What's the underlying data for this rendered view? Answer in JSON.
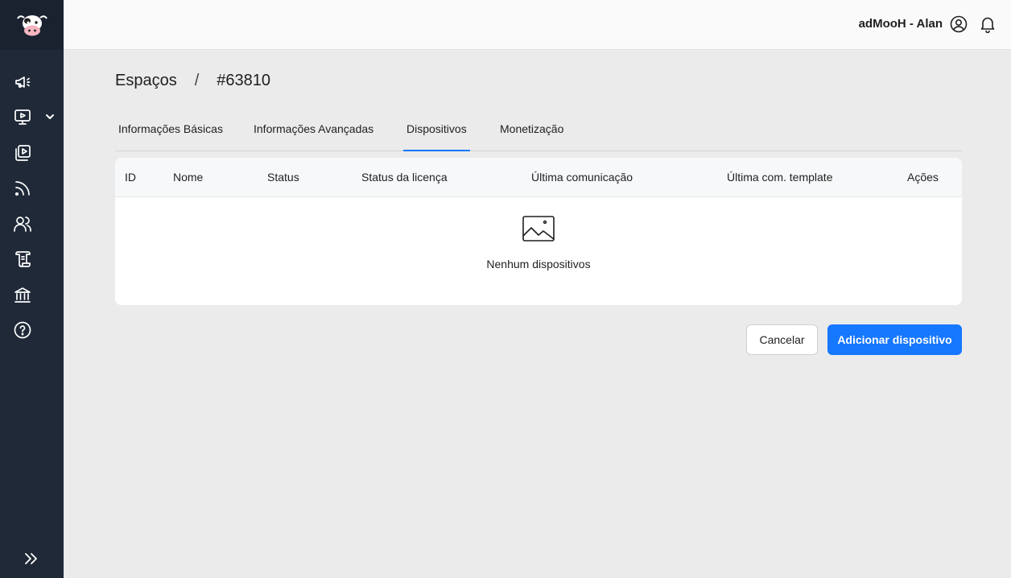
{
  "app": {
    "user_label": "adMooH - Alan"
  },
  "sidebar": {
    "items": [
      {
        "icon": "megaphone-icon"
      },
      {
        "icon": "screen-play-icon"
      },
      {
        "icon": "media-library-icon"
      },
      {
        "icon": "rss-feed-icon"
      },
      {
        "icon": "users-icon"
      },
      {
        "icon": "scroll-icon"
      },
      {
        "icon": "bank-icon"
      },
      {
        "icon": "help-icon"
      }
    ]
  },
  "breadcrumb": {
    "parent": "Espaços",
    "separator": "/",
    "current": "#63810"
  },
  "tabs": [
    {
      "label": "Informações Básicas",
      "active": false
    },
    {
      "label": "Informações Avançadas",
      "active": false
    },
    {
      "label": "Dispositivos",
      "active": true
    },
    {
      "label": "Monetização",
      "active": false
    }
  ],
  "table": {
    "columns": [
      "ID",
      "Nome",
      "Status",
      "Status da licença",
      "Última comunicação",
      "Última com. template",
      "Ações"
    ],
    "empty_text": "Nenhum dispositivos"
  },
  "actions": {
    "cancel_label": "Cancelar",
    "add_label": "Adicionar dispositivo"
  },
  "colors": {
    "sidebar_bg": "#1f2937",
    "accent": "#1677ff",
    "page_bg": "#ebebeb"
  }
}
